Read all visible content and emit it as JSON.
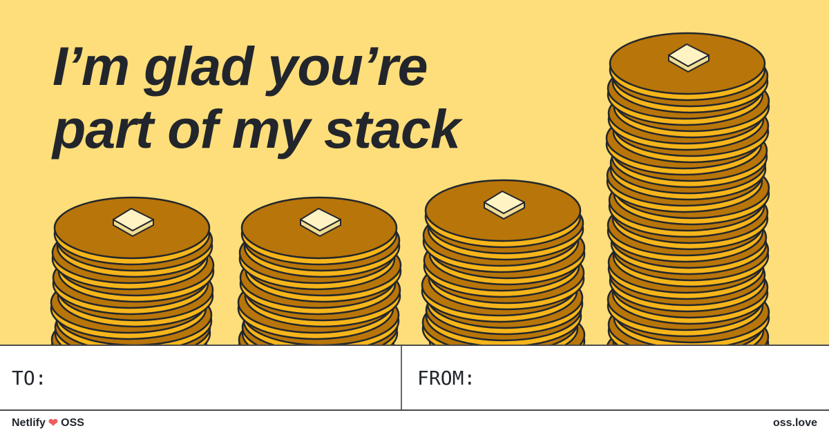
{
  "headline": {
    "line1": "I’m glad you’re",
    "line2": "part of my stack"
  },
  "illustration": {
    "stacks": 4,
    "icon": "pancake-stack-icon"
  },
  "fields": {
    "to_label": "TO:",
    "to_value": "",
    "from_label": "FROM:",
    "from_value": ""
  },
  "footer": {
    "brand_left": "Netlify",
    "heart": "❤",
    "brand_right": "OSS",
    "site": "oss.love"
  },
  "colors": {
    "background": "#fede7a",
    "pancake": "#b87509",
    "pancake_edge": "#f6b51a",
    "butter": "#fff3c4",
    "outline": "#22262c",
    "heart": "#ec5e5e"
  }
}
